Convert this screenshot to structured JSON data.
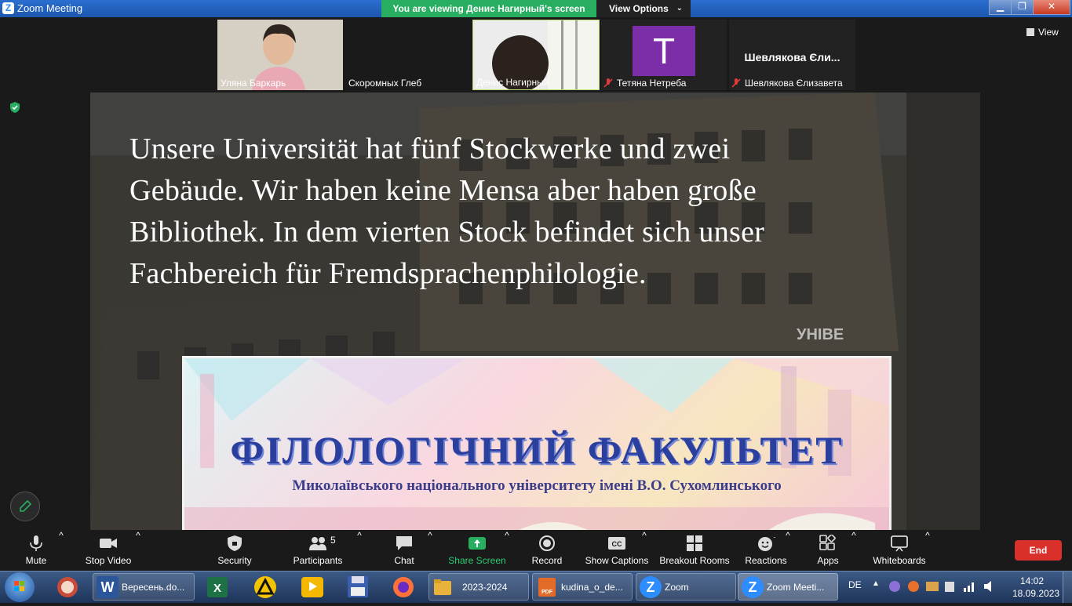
{
  "window": {
    "title": "Zoom Meeting"
  },
  "banner": {
    "viewing": "You are viewing Денис Нагирный's screen",
    "view_options": "View Options"
  },
  "view_button": "View",
  "participants": [
    {
      "name": "Уляна Баркарь",
      "muted": false
    },
    {
      "name": "Скоромных Глеб",
      "muted": false
    },
    {
      "name": "Денис Нагирный",
      "muted": false
    },
    {
      "name": "Тетяна Нетреба",
      "muted": true,
      "initial": "T"
    },
    {
      "name": "Шевлякова Єлизавета",
      "muted": true,
      "display": "Шевлякова Єли..."
    }
  ],
  "slide": {
    "lines": [
      "Unsere Universität hat fünf Stockwerke und zwei",
      "Gebäude. Wir haben keine Mensa aber haben große",
      "Bibliothek. In dem vierten Stock befindet sich unser",
      "Fachbereich für Fremdsprachenphilologie."
    ],
    "banner_title": "ФІЛОЛОГІЧНИЙ ФАКУЛЬТЕТ",
    "banner_subtitle": "Миколаївського національного університету імені В.О. Сухомлинського",
    "building_sign": "УНІВЕ"
  },
  "toolbar": {
    "mute": "Mute",
    "stop_video": "Stop Video",
    "security": "Security",
    "participants": "Participants",
    "participants_count": "5",
    "chat": "Chat",
    "share_screen": "Share Screen",
    "record": "Record",
    "captions": "Show Captions",
    "breakout": "Breakout Rooms",
    "reactions": "Reactions",
    "apps": "Apps",
    "whiteboards": "Whiteboards",
    "end": "End"
  },
  "taskbar": {
    "items": [
      {
        "label": "Вересень.do...",
        "icon": "W",
        "color": "#2b579a"
      },
      {
        "label": "2023-2024",
        "icon": "folder",
        "color": "#e8b33a"
      },
      {
        "label": "kudina_o_de...",
        "icon": "pdf",
        "color": "#e36b2a"
      },
      {
        "label": "Zoom",
        "icon": "Z",
        "color": "#2d8cff"
      },
      {
        "label": "Zoom Meeti...",
        "icon": "Z",
        "color": "#2d8cff"
      }
    ],
    "lang": "DE",
    "time": "14:02",
    "date": "18.09.2023"
  },
  "colors": {
    "share_green": "#27ae60",
    "end_red": "#d9302c",
    "zoom_blue": "#2d8cff"
  }
}
